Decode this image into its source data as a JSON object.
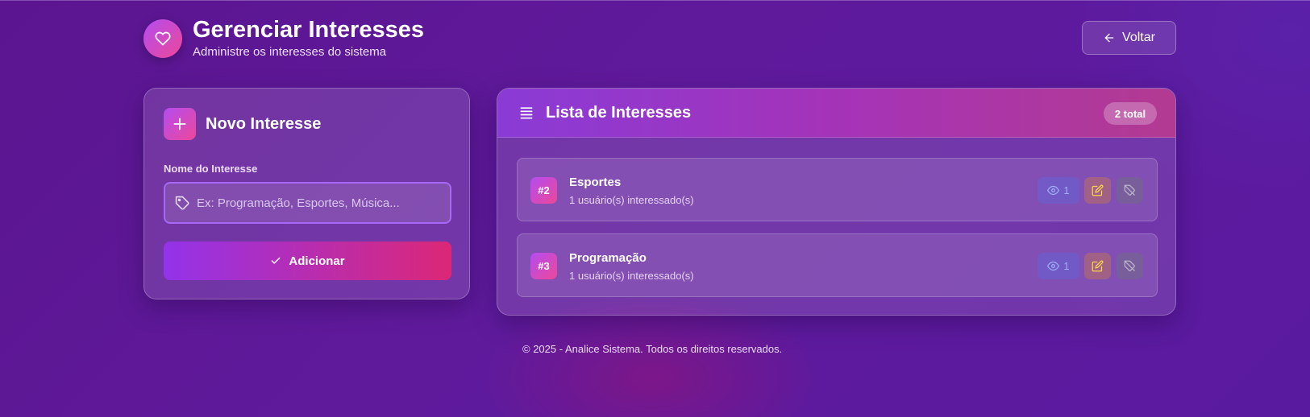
{
  "header": {
    "title": "Gerenciar Interesses",
    "subtitle": "Administre os interesses do sistema",
    "back_label": "Voltar"
  },
  "form": {
    "title": "Novo Interesse",
    "field_label": "Nome do Interesse",
    "input_value": "",
    "input_placeholder": "Ex: Programação, Esportes, Música...",
    "submit_label": "Adicionar"
  },
  "list": {
    "title": "Lista de Interesses",
    "total_badge": "2 total",
    "items": [
      {
        "id": "#2",
        "name": "Esportes",
        "meta": "1 usuário(s) interessado(s)",
        "view_count": "1"
      },
      {
        "id": "#3",
        "name": "Programação",
        "meta": "1 usuário(s) interessado(s)",
        "view_count": "1"
      }
    ]
  },
  "footer": {
    "text": "© 2025 - Analice Sistema. Todos os direitos reservados."
  },
  "icons": {
    "logo": "heart-icon",
    "back": "arrow-left-icon",
    "add_header": "plus-icon",
    "input": "tag-icon",
    "submit": "check-icon",
    "list_header": "list-icon",
    "view": "eye-icon",
    "edit": "edit-icon",
    "delete": "tag-off-icon"
  },
  "colors": {
    "background": "#5b1590",
    "accent_gradient_start": "#9333ea",
    "accent_gradient_end": "#db2777",
    "input_border": "#a668f5"
  }
}
